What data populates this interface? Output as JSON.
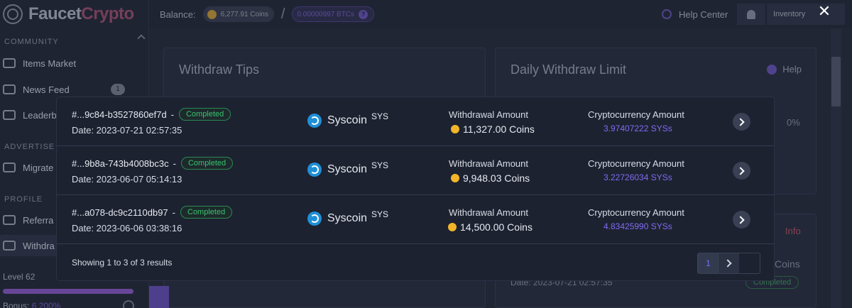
{
  "app": {
    "logo_a": "Faucet",
    "logo_b": "Crypto"
  },
  "sidebar": {
    "sections": {
      "community": "COMMUNITY",
      "advertise": "ADVERTISE",
      "profile": "PROFILE"
    },
    "items": [
      {
        "label": "Items Market"
      },
      {
        "label": "News Feed",
        "badge": "1"
      },
      {
        "label": "Leaderb"
      },
      {
        "label": "Migrate"
      },
      {
        "label": "Referra"
      },
      {
        "label": "Withdra"
      }
    ],
    "level": "Level 62",
    "level_progress": 1.0,
    "bonus_label": "Bonus:",
    "bonus_value": "6.200%"
  },
  "topbar": {
    "balance_label": "Balance:",
    "coins": "6,277.91 Coins",
    "separator": "/",
    "btc": "0.00000997 BTCs",
    "help_center": "Help Center",
    "inventory": "Inventory"
  },
  "background": {
    "withdraw_tips": "Withdraw Tips",
    "daily_limit": "Daily Withdraw Limit",
    "help": "Help",
    "percent": "0%",
    "info": "Info",
    "coins": "Coins",
    "date": "Date: 2023-07-21 02:57:35",
    "status": "Completed"
  },
  "modal": {
    "rows": [
      {
        "id": "#...9c84-b3527860ef7d",
        "dash": "-",
        "status": "Completed",
        "date": "Date: 2023-07-21 02:57:35",
        "coin": "Syscoin",
        "ticker": "SYS",
        "withdrawal_label": "Withdrawal Amount",
        "withdrawal_value": "11,327.00 Coins",
        "crypto_label": "Cryptocurrency Amount",
        "crypto_value": "3.97407222 SYSs"
      },
      {
        "id": "#...9b8a-743b4008bc3c",
        "dash": "-",
        "status": "Completed",
        "date": "Date: 2023-06-07 05:14:13",
        "coin": "Syscoin",
        "ticker": "SYS",
        "withdrawal_label": "Withdrawal Amount",
        "withdrawal_value": "9,948.03 Coins",
        "crypto_label": "Cryptocurrency Amount",
        "crypto_value": "3.22726034 SYSs"
      },
      {
        "id": "#...a078-dc9c2110db97",
        "dash": "-",
        "status": "Completed",
        "date": "Date: 2023-06-06 03:38:16",
        "coin": "Syscoin",
        "ticker": "SYS",
        "withdrawal_label": "Withdrawal Amount",
        "withdrawal_value": "14,500.00 Coins",
        "crypto_label": "Cryptocurrency Amount",
        "crypto_value": "4.83425990 SYSs"
      }
    ],
    "footer": "Showing 1 to 3 of 3 results",
    "page": "1",
    "close": "✕"
  },
  "colors": {
    "accent": "#7f6bf0",
    "status_green": "#39c26f",
    "coin_gold": "#f2b52a",
    "syscoin_blue": "#1f8fd6"
  }
}
